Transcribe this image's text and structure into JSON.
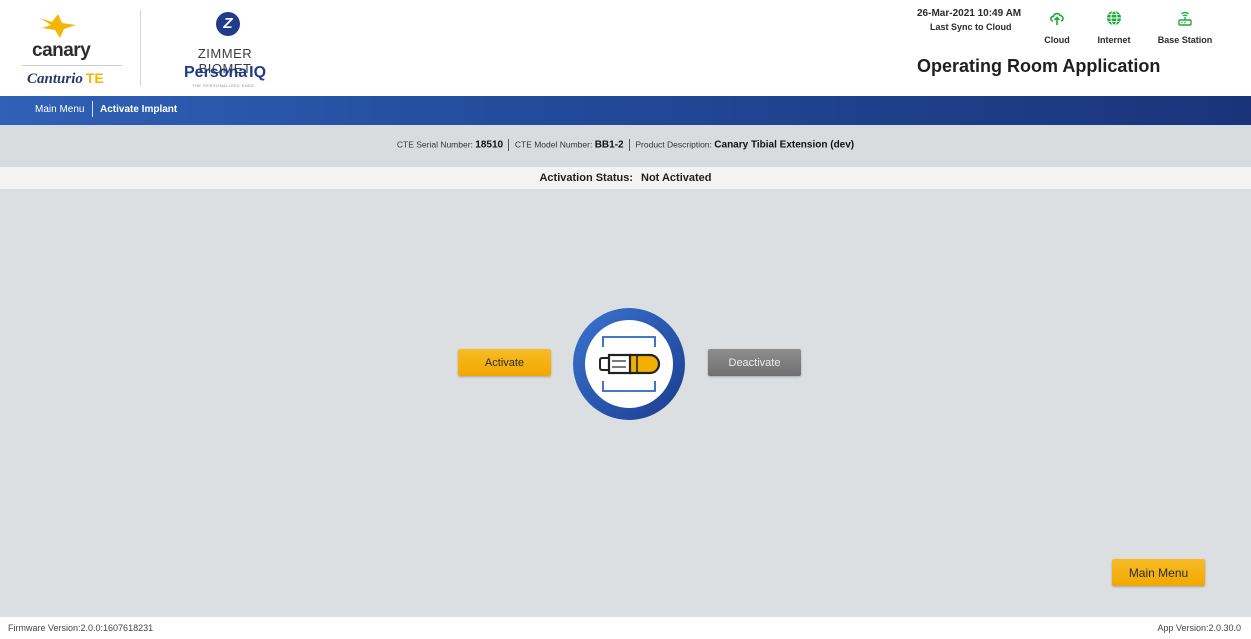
{
  "header": {
    "canary_logo_text": "canary",
    "canturio_text": "Canturio",
    "canturio_suffix": "TE",
    "zimmer_text": "ZIMMER BIOMET",
    "persona_text": "Persona",
    "persona_suffix": "IQ",
    "persona_tagline": "THE PERSONALIZED KNEE",
    "datetime": "26-Mar-2021 10:49 AM",
    "last_sync": "Last Sync to Cloud",
    "status_items": [
      {
        "label": "Cloud",
        "icon": "cloud-upload-icon",
        "color": "#1faa3a"
      },
      {
        "label": "Internet",
        "icon": "globe-icon",
        "color": "#1faa3a"
      },
      {
        "label": "Base Station",
        "icon": "router-icon",
        "color": "#1faa3a"
      }
    ],
    "app_title": "Operating Room Application"
  },
  "breadcrumb": {
    "items": [
      "Main Menu",
      "Activate Implant"
    ]
  },
  "device_info": {
    "serial_label": "CTE Serial Number:",
    "serial_value": "18510",
    "model_label": "CTE Model Number:",
    "model_value": "BB1-2",
    "description_label": "Product Description:",
    "description_value": "Canary Tibial Extension (dev)"
  },
  "activation": {
    "status_label": "Activation Status:",
    "status_value": "Not Activated"
  },
  "buttons": {
    "activate": "Activate",
    "deactivate": "Deactivate",
    "main_menu": "Main Menu"
  },
  "footer": {
    "firmware": "Firmware Version:2.0.0:1607618231",
    "app_version": "App Version:2.0.30.0"
  },
  "colors": {
    "brand_blue": "#1f3b8a",
    "nav_blue": "#2a56a8",
    "accent_yellow": "#f6b500",
    "status_green": "#1faa3a",
    "disabled_gray": "#7a7a7a"
  }
}
